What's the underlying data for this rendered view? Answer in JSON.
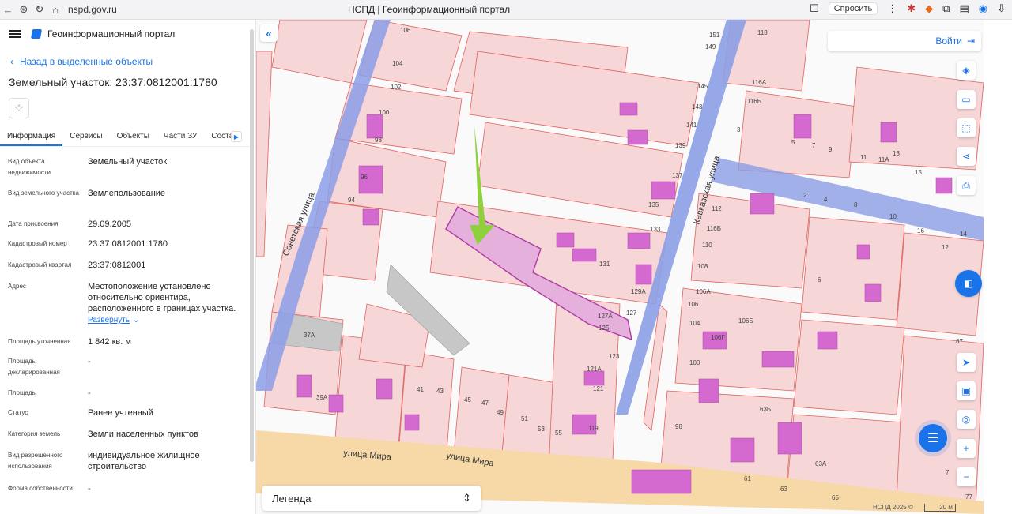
{
  "browser": {
    "url": "nspd.gov.ru",
    "tab_title": "НСПД | Геоинформационный портал",
    "ask_label": "Спросить"
  },
  "app": {
    "title": "Геоинформационный портал",
    "back_label": "Назад в выделенные объекты",
    "object_title": "Земельный участок: 23:37:0812001:1780"
  },
  "tabs": [
    "Информация",
    "Сервисы",
    "Объекты",
    "Части ЗУ",
    "Соста"
  ],
  "properties": [
    {
      "key": "Вид объекта недвижимости",
      "value": "Земельный участок"
    },
    {
      "key": "Вид земельного участка",
      "value": "Землепользование"
    },
    {
      "key": "Дата присвоения",
      "value": "29.09.2005"
    },
    {
      "key": "Кадастровый номер",
      "value": "23:37:0812001:1780"
    },
    {
      "key": "Кадастровый квартал",
      "value": "23:37:0812001"
    },
    {
      "key": "Адрес",
      "value": "Местоположение установлено относительно ориентира, расположенного в границах участка."
    },
    {
      "key": "Площадь уточненная",
      "value": "1 842 кв. м"
    },
    {
      "key": "Площадь декларированная",
      "value": "-"
    },
    {
      "key": "Площадь",
      "value": "-"
    },
    {
      "key": "Статус",
      "value": "Ранее учтенный"
    },
    {
      "key": "Категория земель",
      "value": "Земли населенных пунктов"
    },
    {
      "key": "Вид разрешенного использования",
      "value": "индивидуальное жилищное строительство"
    },
    {
      "key": "Форма собственности",
      "value": "-"
    }
  ],
  "expand_label": "Развернуть",
  "map": {
    "login_label": "Войти",
    "legend_label": "Легенда",
    "copyright": "НСПД 2025 ©",
    "scale_label": "20 м",
    "streets": {
      "sovetskaya": "Советская улица",
      "kavkazskaya": "Кавказская улица",
      "mira": "улица Мира"
    },
    "house_numbers": [
      "106",
      "104",
      "102",
      "100",
      "98",
      "96",
      "94",
      "37А",
      "39А",
      "41",
      "43",
      "45",
      "47",
      "49",
      "51",
      "53",
      "55",
      "119",
      "121",
      "121А",
      "123",
      "125",
      "127",
      "127А",
      "129А",
      "131",
      "133",
      "135",
      "137",
      "139",
      "141",
      "143",
      "145",
      "149",
      "151",
      "118",
      "116А",
      "116Б",
      "112",
      "116Б",
      "110",
      "108",
      "106А",
      "106",
      "104",
      "106Б",
      "106Г",
      "100",
      "98",
      "63Б",
      "61",
      "63",
      "65",
      "63А",
      "3",
      "5",
      "7",
      "9",
      "11",
      "11А",
      "13",
      "15",
      "2",
      "4",
      "6",
      "8",
      "10",
      "12",
      "14",
      "16",
      "87",
      "77",
      "7"
    ],
    "colors": {
      "parcel_fill": "#f6d6d6",
      "parcel_stroke": "#e0635f",
      "building": "#d46ad0",
      "selected_fill": "#e5b0dc",
      "selected_stroke": "#b03ba6",
      "road_blue": "#8c9ee6",
      "road_yellow": "#f7d9a8",
      "arrow": "#8ed13c",
      "accent": "#1a73e8"
    }
  }
}
